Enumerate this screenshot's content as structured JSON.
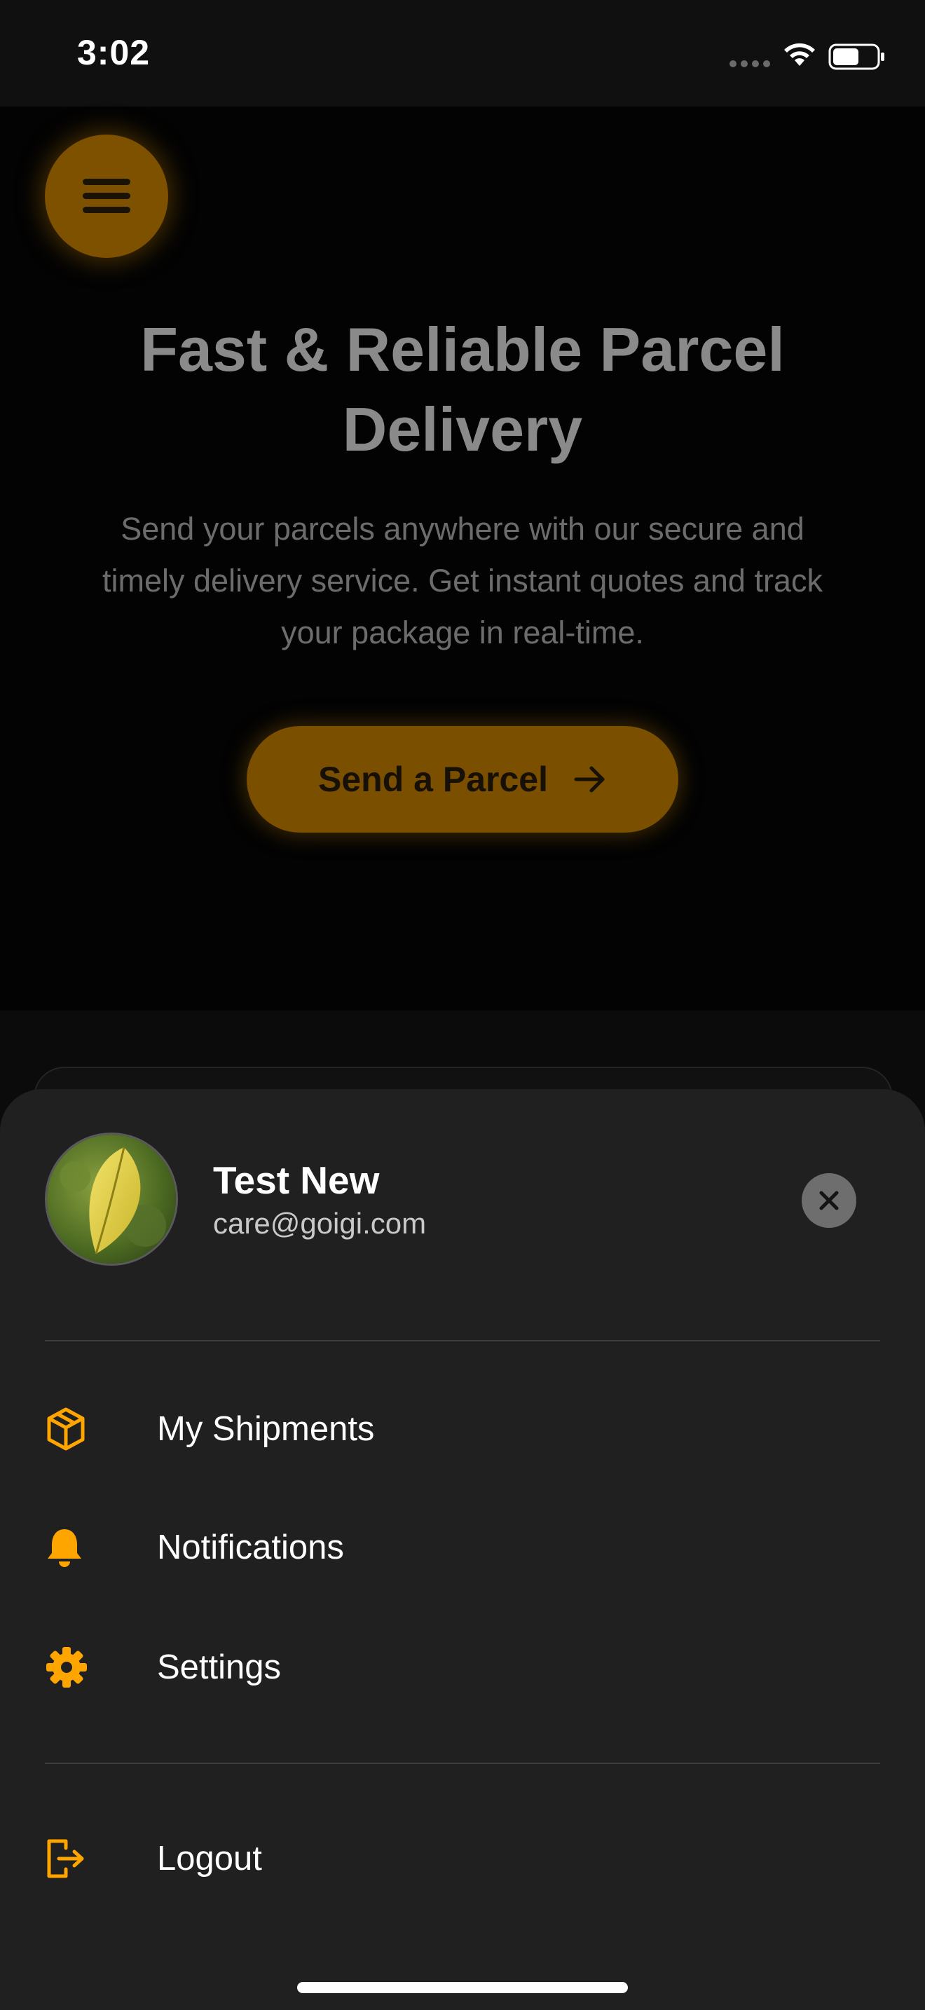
{
  "status_bar": {
    "time": "3:02",
    "signal_icon": "cellular-dots-icon",
    "wifi_icon": "wifi-icon",
    "battery_icon": "battery-icon",
    "battery_level": 0.6
  },
  "hero": {
    "menu_icon": "hamburger-icon",
    "title": "Fast & Reliable Parcel Delivery",
    "subtitle": "Send your parcels anywhere with our secure and timely delivery service. Get instant quotes and track your package in real-time.",
    "cta_label": "Send a Parcel",
    "cta_icon": "arrow-right-icon"
  },
  "drawer": {
    "user": {
      "name": "Test New",
      "email": "care@goigi.com",
      "avatar": "leaf-photo-avatar"
    },
    "close_icon": "close-icon",
    "items": [
      {
        "label": "My Shipments",
        "icon": "package-icon"
      },
      {
        "label": "Notifications",
        "icon": "bell-icon"
      },
      {
        "label": "Settings",
        "icon": "gear-icon"
      }
    ],
    "logout": {
      "label": "Logout",
      "icon": "logout-icon"
    }
  },
  "colors": {
    "accent": "#FFA500",
    "hero_button_dimmed": "#7A4F00",
    "drawer_bg": "#202020",
    "page_bg": "#030303"
  }
}
